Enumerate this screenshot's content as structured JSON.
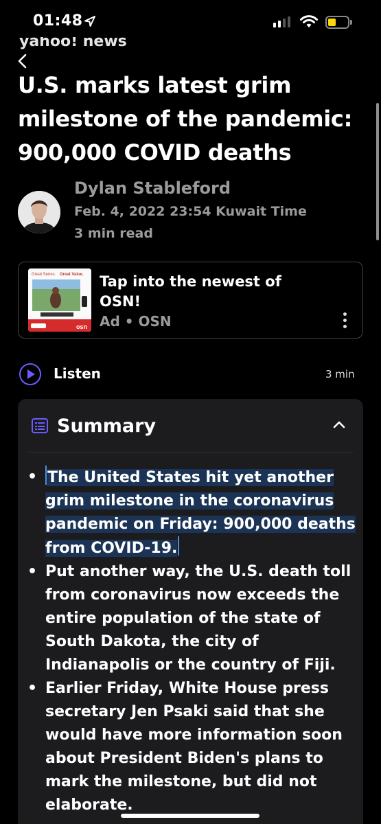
{
  "status_bar": {
    "time": "01:48"
  },
  "header": {
    "brand": "yahoo! news"
  },
  "article": {
    "title": "U.S. marks latest grim milestone of the pandemic: 900,000 COVID deaths",
    "author": "Dylan Stableford",
    "date": "Feb. 4, 2022 23:54 Kuwait Time",
    "read_time": "3 min read"
  },
  "ad": {
    "title": "Tap into the newest of OSN!",
    "meta": "Ad • OSN",
    "image_tagline_a": "Great Series.",
    "image_tagline_b": "Great Value.",
    "image_logo": "osn"
  },
  "listen": {
    "label": "Listen",
    "duration": "3 min"
  },
  "summary": {
    "title": "Summary",
    "bullets": [
      "The United States hit yet another grim milestone in the coronavirus pandemic on Friday: 900,000 deaths from COVID-19.",
      "Put another way, the U.S. death toll from coronavirus now exceeds the entire population of the state of South Dakota, the city of Indianapolis or the country of Fiji.",
      "Earlier Friday, White House press secretary Jen Psaki said that she would have more information soon about President Biden's plans to mark the milestone, but did not elaborate."
    ]
  },
  "colors": {
    "accent": "#6a5cff",
    "background": "#000000",
    "card": "#1c1c1e",
    "battery": "#ffd60a"
  }
}
